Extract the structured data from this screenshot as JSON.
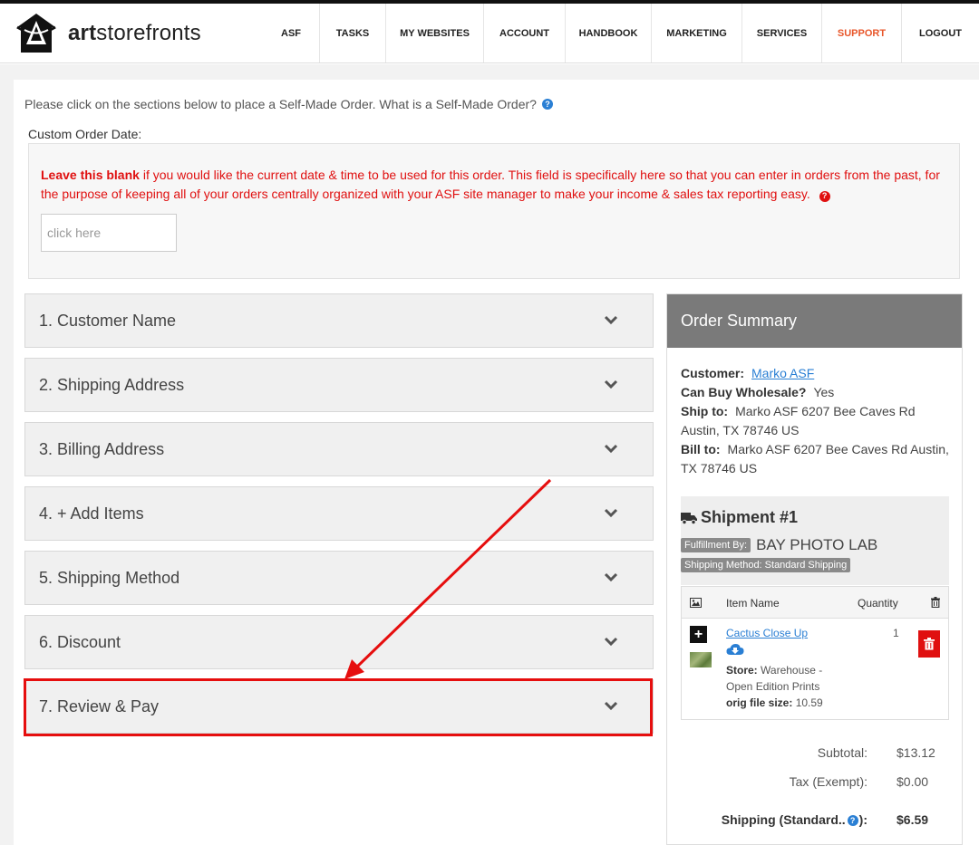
{
  "brand": {
    "name_bold": "art",
    "name_rest": "storefronts"
  },
  "nav": [
    {
      "label": "ASF",
      "active": false
    },
    {
      "label": "TASKS",
      "active": false
    },
    {
      "label": "MY WEBSITES",
      "active": false
    },
    {
      "label": "ACCOUNT",
      "active": false
    },
    {
      "label": "HANDBOOK",
      "active": false
    },
    {
      "label": "MARKETING",
      "active": false
    },
    {
      "label": "SERVICES",
      "active": false
    },
    {
      "label": "SUPPORT",
      "active": true
    },
    {
      "label": "LOGOUT",
      "active": false
    }
  ],
  "intro": {
    "text": "Please click on the sections below to place a Self-Made Order. What is a Self-Made Order?"
  },
  "custom_date": {
    "label": "Custom Order Date:",
    "notice_bold": "Leave this blank",
    "notice_rest": " if you would like the current date & time to be used for this order. This field is specifically here so that you can enter in orders from the past, for the purpose of keeping all of your orders centrally organized with your ASF site manager to make your income & sales tax reporting easy.",
    "placeholder": "click here",
    "value": ""
  },
  "sections": [
    {
      "label": "1. Customer Name"
    },
    {
      "label": "2. Shipping Address"
    },
    {
      "label": "3. Billing Address"
    },
    {
      "label": "4. + Add Items"
    },
    {
      "label": "5. Shipping Method"
    },
    {
      "label": "6. Discount"
    },
    {
      "label": "7. Review & Pay"
    }
  ],
  "summary": {
    "title": "Order Summary",
    "customer_label": "Customer:",
    "customer_value": "Marko ASF",
    "wholesale_label": "Can Buy Wholesale?",
    "wholesale_value": "Yes",
    "ship_label": "Ship to:",
    "ship_value": "Marko ASF 6207 Bee Caves Rd Austin, TX 78746 US",
    "bill_label": "Bill to:",
    "bill_value": "Marko ASF 6207 Bee Caves Rd Austin, TX 78746 US",
    "shipment": {
      "title": "Shipment #1",
      "fulfillment_badge": "Fulfillment By:",
      "fulfillment_value": "BAY PHOTO LAB",
      "method_badge": "Shipping Method: Standard Shipping"
    },
    "table": {
      "col_name": "Item Name",
      "col_qty": "Quantity",
      "item": {
        "name": "Cactus Close Up",
        "store_label": "Store:",
        "store_value": "Warehouse - Open Edition Prints",
        "size_label": "orig file size:",
        "size_value": "10.59",
        "quantity": "1"
      }
    },
    "totals": {
      "subtotal_label": "Subtotal:",
      "subtotal_value": "$13.12",
      "tax_label": "Tax (Exempt):",
      "tax_value": "$0.00",
      "shipping_label_a": "Shipping (Standard..",
      "shipping_label_b": "):",
      "shipping_value": "$6.59"
    }
  },
  "colors": {
    "accent": "#e8562a",
    "link": "#2a7fd4",
    "alert": "#e01010",
    "summary_header": "#7a7a7a"
  }
}
